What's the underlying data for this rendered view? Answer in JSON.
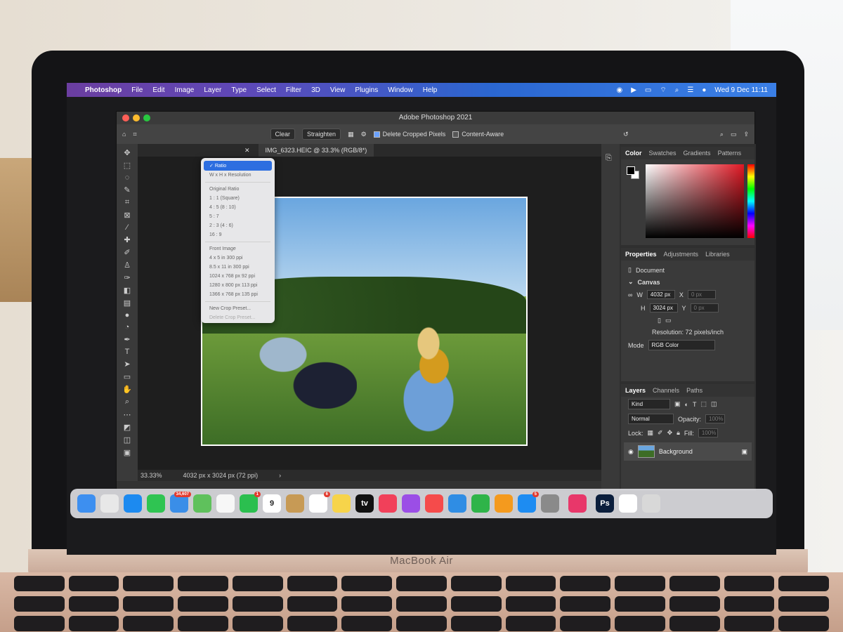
{
  "menubar": {
    "items": [
      "Photoshop",
      "File",
      "Edit",
      "Image",
      "Layer",
      "Type",
      "Select",
      "Filter",
      "3D",
      "View",
      "Plugins",
      "Window",
      "Help"
    ],
    "clock": "Wed 9 Dec  11:11"
  },
  "window": {
    "title": "Adobe Photoshop 2021"
  },
  "options": {
    "clear_label": "Clear",
    "straighten_label": "Straighten",
    "delete_cropped_label": "Delete Cropped Pixels",
    "content_aware_label": "Content-Aware"
  },
  "dropdown": {
    "selected": "Ratio",
    "items": [
      "W x H x Resolution",
      "Original Ratio",
      "1 : 1 (Square)",
      "4 : 5 (8 : 10)",
      "5 : 7",
      "2 : 3 (4 : 6)",
      "16 : 9",
      "Front Image",
      "4 x 5 in 300 ppi",
      "8.5 x 11 in 300 ppi",
      "1024 x 768 px 92 ppi",
      "1280 x 800 px 113 ppi",
      "1366 x 768 px 135 ppi",
      "New Crop Preset...",
      "Delete Crop Preset..."
    ]
  },
  "document": {
    "tab_label": "IMG_6323.HEIC @ 33.3% (RGB/8*)",
    "zoom": "33.33%",
    "size_info": "4032 px x 3024 px (72 ppi)"
  },
  "color_panel": {
    "tabs": [
      "Color",
      "Swatches",
      "Gradients",
      "Patterns"
    ],
    "active": "Color"
  },
  "properties_panel": {
    "tabs": [
      "Properties",
      "Adjustments",
      "Libraries"
    ],
    "active": "Properties",
    "doc_label": "Document",
    "section": "Canvas",
    "w_label": "W",
    "w_value": "4032 px",
    "h_label": "H",
    "h_value": "3024 px",
    "x_label": "X",
    "x_value": "0 px",
    "y_label": "Y",
    "y_value": "0 px",
    "resolution": "Resolution: 72 pixels/inch",
    "mode_label": "Mode",
    "mode_value": "RGB Color"
  },
  "layers_panel": {
    "tabs": [
      "Layers",
      "Channels",
      "Paths"
    ],
    "active": "Layers",
    "filter": "Kind",
    "blend": "Normal",
    "opacity_label": "Opacity:",
    "opacity_value": "100%",
    "lock_label": "Lock:",
    "fill_label": "Fill:",
    "fill_value": "100%",
    "layer_name": "Background"
  },
  "dock": {
    "icons": [
      {
        "name": "finder-icon",
        "color": "#3d8ff0"
      },
      {
        "name": "launchpad-icon",
        "color": "#e8e8e8"
      },
      {
        "name": "safari-icon",
        "color": "#1c8af0"
      },
      {
        "name": "messages-icon",
        "color": "#2fc452"
      },
      {
        "name": "mail-icon",
        "color": "#3a8ee8",
        "badge": "34,607"
      },
      {
        "name": "maps-icon",
        "color": "#5fc15c"
      },
      {
        "name": "photos-icon",
        "color": "#f7f7f7"
      },
      {
        "name": "facetime-icon",
        "color": "#2bbf4f",
        "badge": "1"
      },
      {
        "name": "calendar-icon",
        "color": "#ffffff",
        "text": "9"
      },
      {
        "name": "contacts-icon",
        "color": "#c79a55"
      },
      {
        "name": "reminders-icon",
        "color": "#ffffff",
        "badge": "6"
      },
      {
        "name": "notes-icon",
        "color": "#f7d44a"
      },
      {
        "name": "tv-icon",
        "color": "#111111",
        "text": "tv"
      },
      {
        "name": "music-icon",
        "color": "#f1405a"
      },
      {
        "name": "podcasts-icon",
        "color": "#9b4ee6"
      },
      {
        "name": "news-icon",
        "color": "#f54b4b"
      },
      {
        "name": "keynote-icon",
        "color": "#2f8de4"
      },
      {
        "name": "numbers-icon",
        "color": "#2fb449"
      },
      {
        "name": "pages-icon",
        "color": "#f49a1e"
      },
      {
        "name": "app-store-icon",
        "color": "#1d8cf2",
        "badge": "5"
      },
      {
        "name": "system-preferences-icon",
        "color": "#8a8a8a"
      },
      {
        "name": "creative-cloud-icon",
        "color": "#e8376a"
      },
      {
        "name": "photoshop-icon",
        "color": "#0b1e3c",
        "text": "Ps"
      },
      {
        "name": "downloads-icon",
        "color": "#ffffff"
      },
      {
        "name": "trash-icon",
        "color": "#d8d8d8"
      }
    ]
  },
  "laptop": {
    "brand": "MacBook Air"
  }
}
